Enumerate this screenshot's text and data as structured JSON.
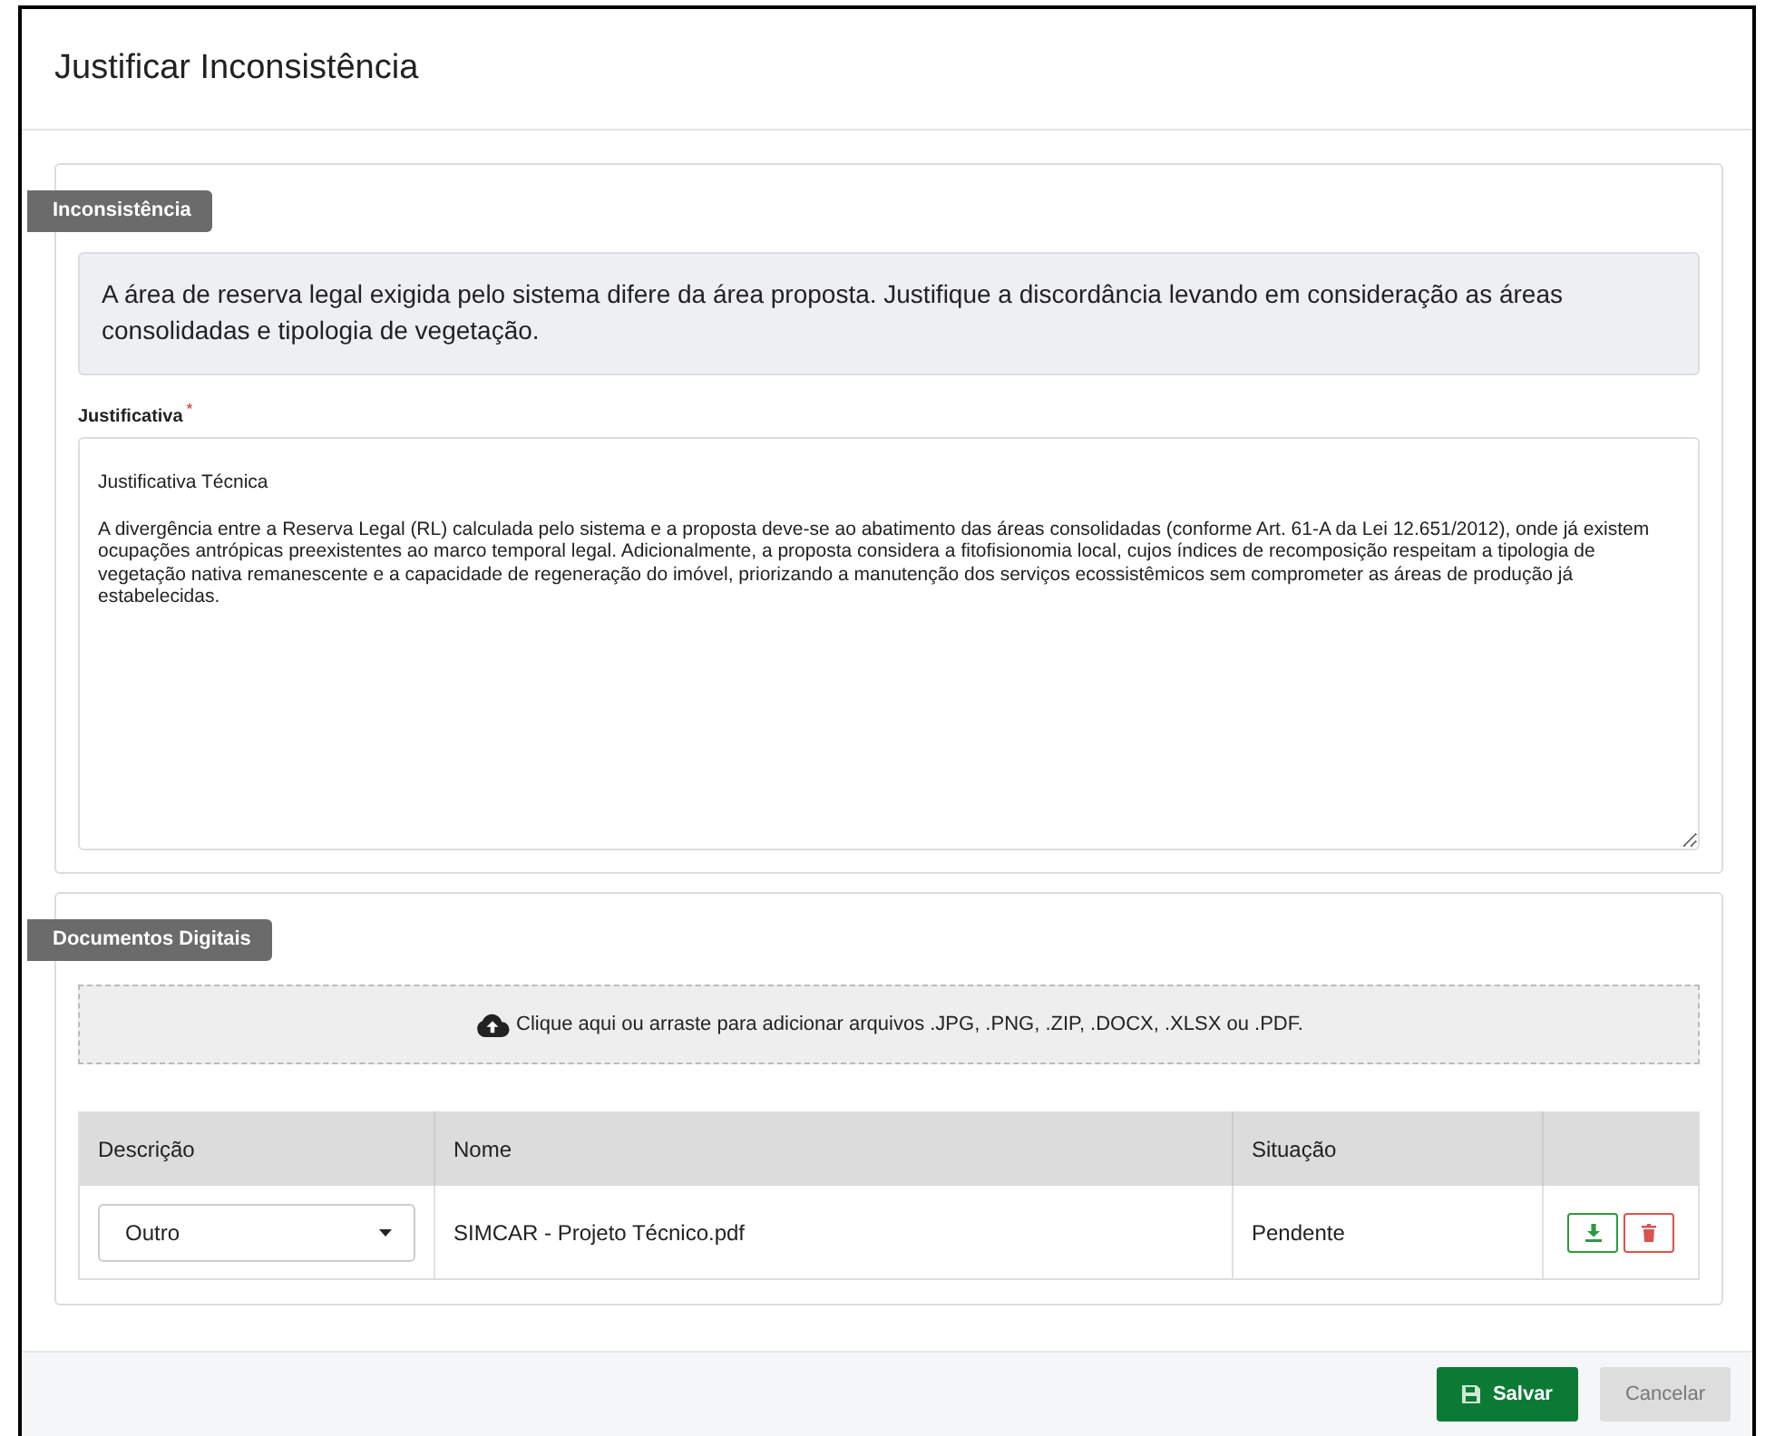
{
  "dialog": {
    "title": "Justificar Inconsistência"
  },
  "inconsistency": {
    "tag": "Inconsistência",
    "message": "A área de reserva legal exigida pelo sistema difere da área proposta. Justifique a discordância levando em consideração as áreas consolidadas e tipologia de vegetação."
  },
  "justification": {
    "label": "Justificativa",
    "required_mark": "*",
    "value": "Justificativa Técnica\n\nA divergência entre a Reserva Legal (RL) calculada pelo sistema e a proposta deve-se ao abatimento das áreas consolidadas (conforme Art. 61-A da Lei 12.651/2012), onde já existem ocupações antrópicas preexistentes ao marco temporal legal. Adicionalmente, a proposta considera a fitofisionomia local, cujos índices de recomposição respeitam a tipologia de vegetação nativa remanescente e a capacidade de regeneração do imóvel, priorizando a manutenção dos serviços ecossistêmicos sem comprometer as áreas de produção já estabelecidas."
  },
  "documents": {
    "tag": "Documentos Digitais",
    "dropzone": "Clique aqui ou arraste para adicionar arquivos .JPG, .PNG, .ZIP, .DOCX, .XLSX ou .PDF.",
    "columns": [
      "Descrição",
      "Nome",
      "Situação"
    ],
    "rows": [
      {
        "description": "Outro",
        "name": "SIMCAR - Projeto Técnico.pdf",
        "status": "Pendente"
      }
    ]
  },
  "buttons": [
    {
      "label": "Salvar",
      "kind": "primary"
    },
    {
      "label": "Cancelar",
      "kind": "secondary"
    }
  ]
}
